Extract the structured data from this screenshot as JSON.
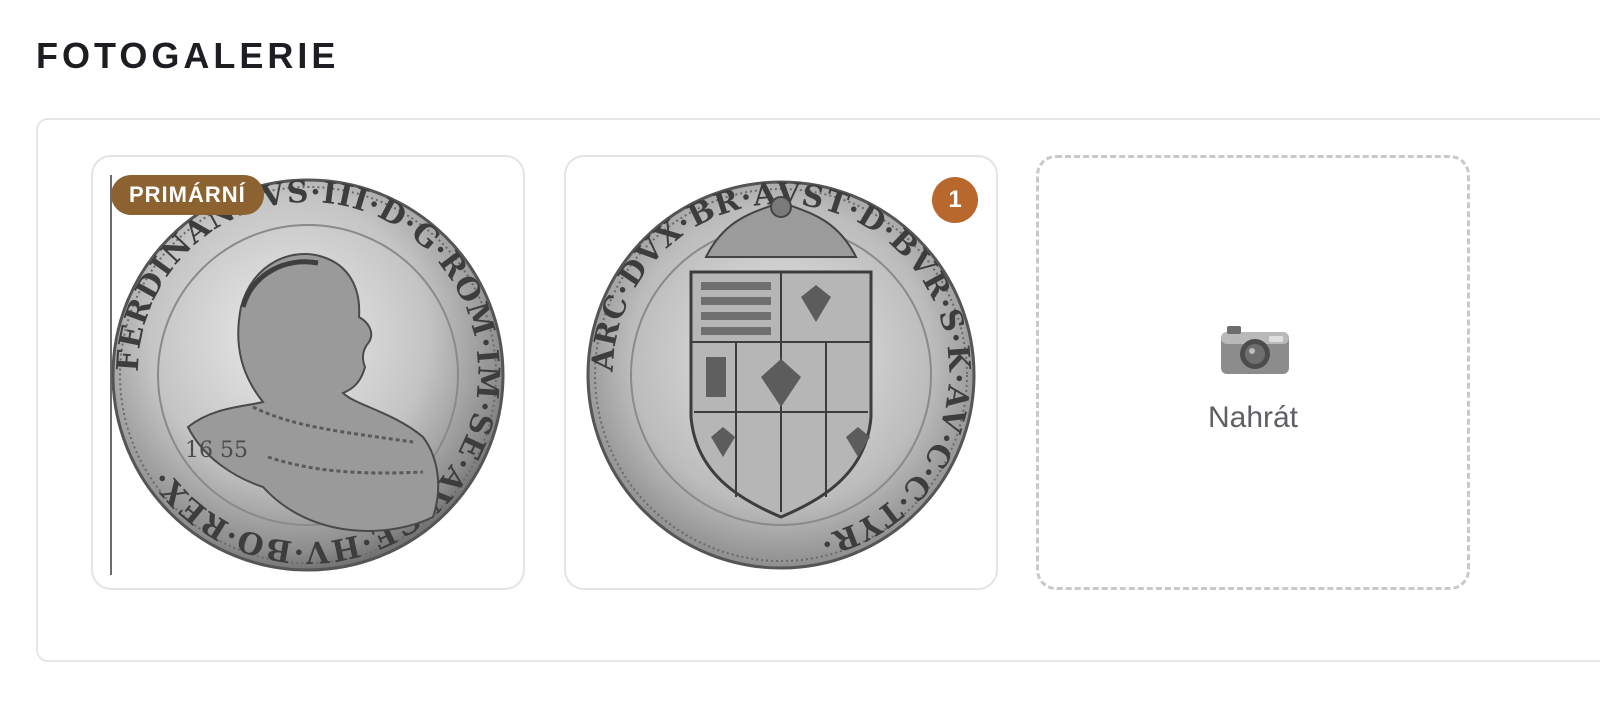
{
  "gallery": {
    "title": "FOTOGALERIE",
    "photos": [
      {
        "badge": "PRIMÁRNÍ",
        "coin_legend": "FERDINANDVS·III·D·G·ROM·IM·SE·AV·GE·HV·BO·REX·",
        "coin_year": "16 55"
      },
      {
        "badge": "1",
        "coin_legend": "ARC·DVX·BR·AVST·D·BVR·S·K·AV·C·C·TYR·"
      }
    ],
    "upload": {
      "label": "Nahrát",
      "icon": "camera-icon"
    }
  },
  "colors": {
    "primary_badge": "#8b6230",
    "count_badge": "#b8682c",
    "title": "#1e1e22",
    "dashed_border": "#c9c9cc"
  }
}
